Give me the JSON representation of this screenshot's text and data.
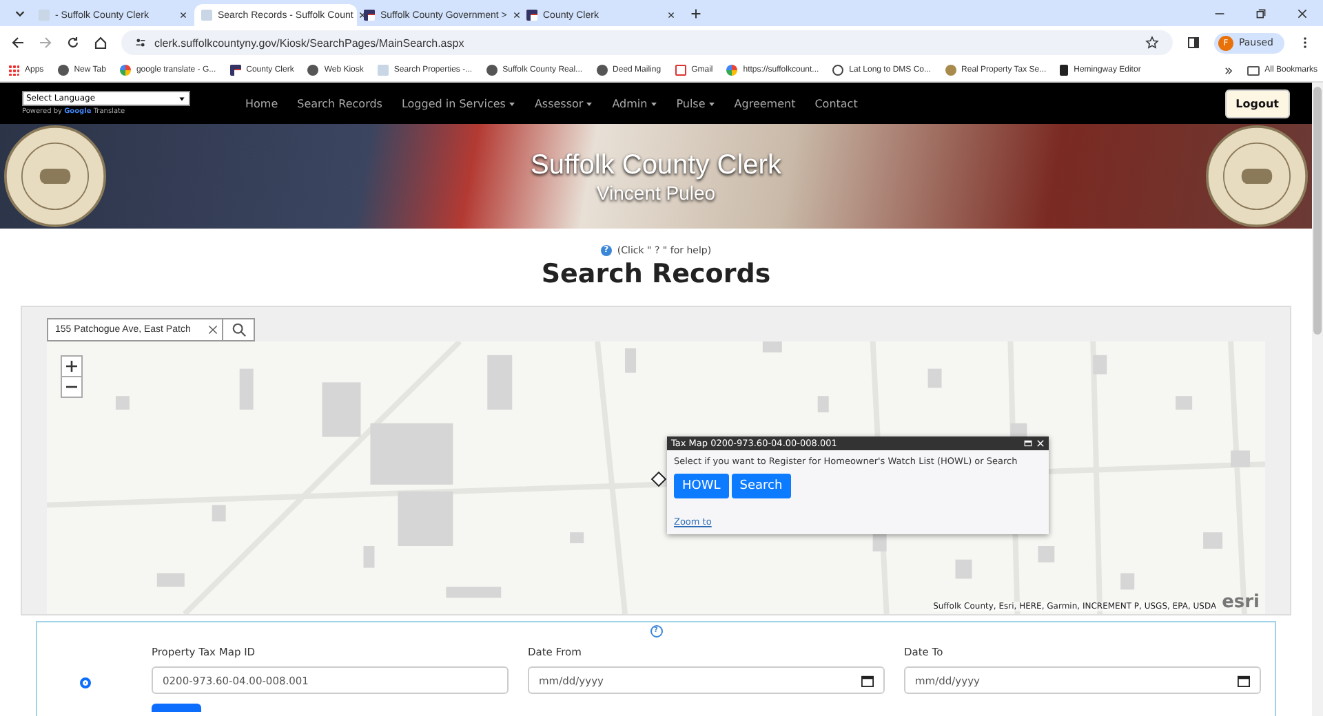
{
  "browser": {
    "tabs": [
      {
        "title": "- Suffolk County Clerk",
        "kind": "page",
        "selected": false
      },
      {
        "title": "Search Records - Suffolk Count",
        "kind": "page",
        "selected": true
      },
      {
        "title": "Suffolk County Government >",
        "kind": "flag",
        "selected": false
      },
      {
        "title": "County Clerk",
        "kind": "flag",
        "selected": false
      }
    ],
    "url": "clerk.suffolkcountyny.gov/Kiosk/SearchPages/MainSearch.aspx",
    "profile": {
      "initial": "F",
      "label": "Paused"
    },
    "bookmarks": [
      {
        "label": "Apps",
        "kind": "apps"
      },
      {
        "label": "New Tab",
        "kind": "globe"
      },
      {
        "label": "google translate - G...",
        "kind": "google"
      },
      {
        "label": "County Clerk",
        "kind": "flag"
      },
      {
        "label": "Web Kiosk",
        "kind": "globe"
      },
      {
        "label": "Search Properties -...",
        "kind": "page"
      },
      {
        "label": "Suffolk County Real...",
        "kind": "globe"
      },
      {
        "label": "Deed Mailing",
        "kind": "globe"
      },
      {
        "label": "Gmail",
        "kind": "gmail"
      },
      {
        "label": "https://suffolkcount...",
        "kind": "google"
      },
      {
        "label": "Lat Long to DMS Co...",
        "kind": "compass"
      },
      {
        "label": "Real Property Tax Se...",
        "kind": "seal"
      },
      {
        "label": "Hemingway Editor",
        "kind": "editor"
      }
    ],
    "all_bookmarks": "All Bookmarks"
  },
  "site_nav": {
    "language": "Select Language",
    "powered_by": "Powered by **Google** Translate",
    "items": [
      {
        "label": "Home",
        "dropdown": false
      },
      {
        "label": "Search Records",
        "dropdown": false
      },
      {
        "label": "Logged in Services",
        "dropdown": true
      },
      {
        "label": "Assessor",
        "dropdown": true
      },
      {
        "label": "Admin",
        "dropdown": true
      },
      {
        "label": "Pulse",
        "dropdown": true
      },
      {
        "label": "Agreement",
        "dropdown": false
      },
      {
        "label": "Contact",
        "dropdown": false
      }
    ],
    "logout": "Logout"
  },
  "banner": {
    "title": "Suffolk County Clerk",
    "subtitle": "Vincent Puleo"
  },
  "help_icon": "?",
  "help": "(Click \" ? \" for help)",
  "heading": "Search Records",
  "map": {
    "search_value": "155 Patchogue Ave, East Patch",
    "popup": {
      "title": "Tax Map 0200-973.60-04.00-008.001",
      "text": "Select if you want to Register for Homeowner's Watch List (HOWL) or Search",
      "buttons": [
        "HOWL",
        "Search"
      ],
      "link": "Zoom to"
    },
    "attribution": "Suffolk County, Esri, HERE, Garmin, INCREMENT P, USGS, EPA, USDA",
    "logo": "esri"
  },
  "form": {
    "help_icon": "?",
    "radio_selected": true,
    "fields": [
      {
        "label": "Property Tax Map ID",
        "kind": "text",
        "value": "0200-973.60-04.00-008.001"
      },
      {
        "label": "Date From",
        "kind": "date",
        "placeholder": "mm/dd/yyyy"
      },
      {
        "label": "Date To",
        "kind": "date",
        "placeholder": "mm/dd/yyyy"
      }
    ]
  }
}
